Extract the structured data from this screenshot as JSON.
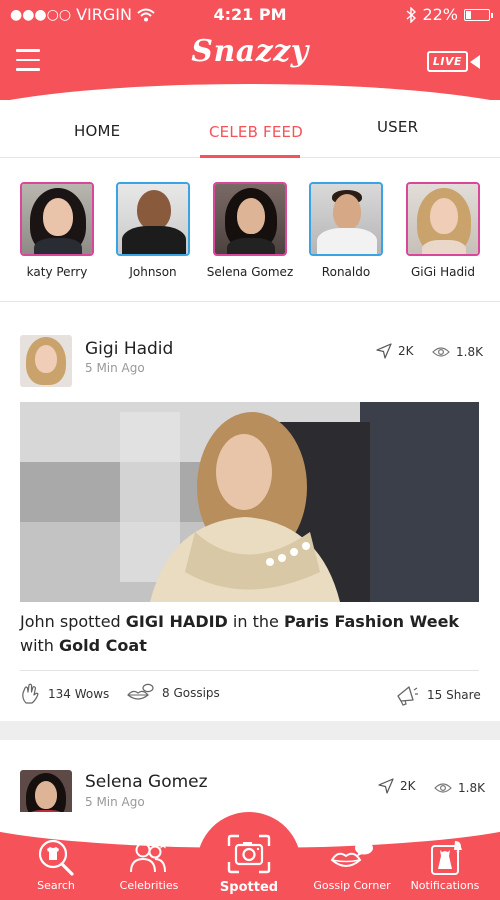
{
  "status_bar": {
    "carrier": "VIRGIN",
    "time": "4:21 PM",
    "battery": "22%",
    "battery_level": 0.22
  },
  "header": {
    "app_title": "Snazzy",
    "live_label": "LIVE"
  },
  "tabs": [
    {
      "label": "HOME",
      "active": false
    },
    {
      "label": "CELEB FEED",
      "active": true
    },
    {
      "label": "USER",
      "active": false
    }
  ],
  "celebrities": [
    {
      "name": "katy Perry"
    },
    {
      "name": "Johnson"
    },
    {
      "name": "Selena Gomez"
    },
    {
      "name": "Ronaldo"
    },
    {
      "name": "GiGi Hadid"
    }
  ],
  "posts": [
    {
      "author": "Gigi Hadid",
      "time": "5 Min Ago",
      "shares_count": "2K",
      "views_count": "1.8K",
      "caption_parts": {
        "p1": "John spotted ",
        "p2": "GIGI HADID",
        "p3": "  in the ",
        "p4": "Paris Fashion Week",
        "p5": "with ",
        "p6": "Gold Coat"
      },
      "wows": "134 Wows",
      "gossips": "8 Gossips",
      "share": "15 Share"
    },
    {
      "author": "Selena Gomez",
      "time": "5 Min Ago",
      "shares_count": "2K",
      "views_count": "1.8K"
    }
  ],
  "bottom_nav": [
    {
      "label": "Search",
      "icon": "search-shirt-icon"
    },
    {
      "label": "Celebrities",
      "icon": "people-icon"
    },
    {
      "label": "Spotted",
      "icon": "camera-icon",
      "active": true
    },
    {
      "label": "Gossip Corner",
      "icon": "lips-chat-icon"
    },
    {
      "label": "Notifications",
      "icon": "dress-bell-icon"
    }
  ],
  "colors": {
    "brand": "#f6525a",
    "celeb_border_pink": "#d8479a",
    "celeb_border_blue": "#3aa3e3"
  }
}
